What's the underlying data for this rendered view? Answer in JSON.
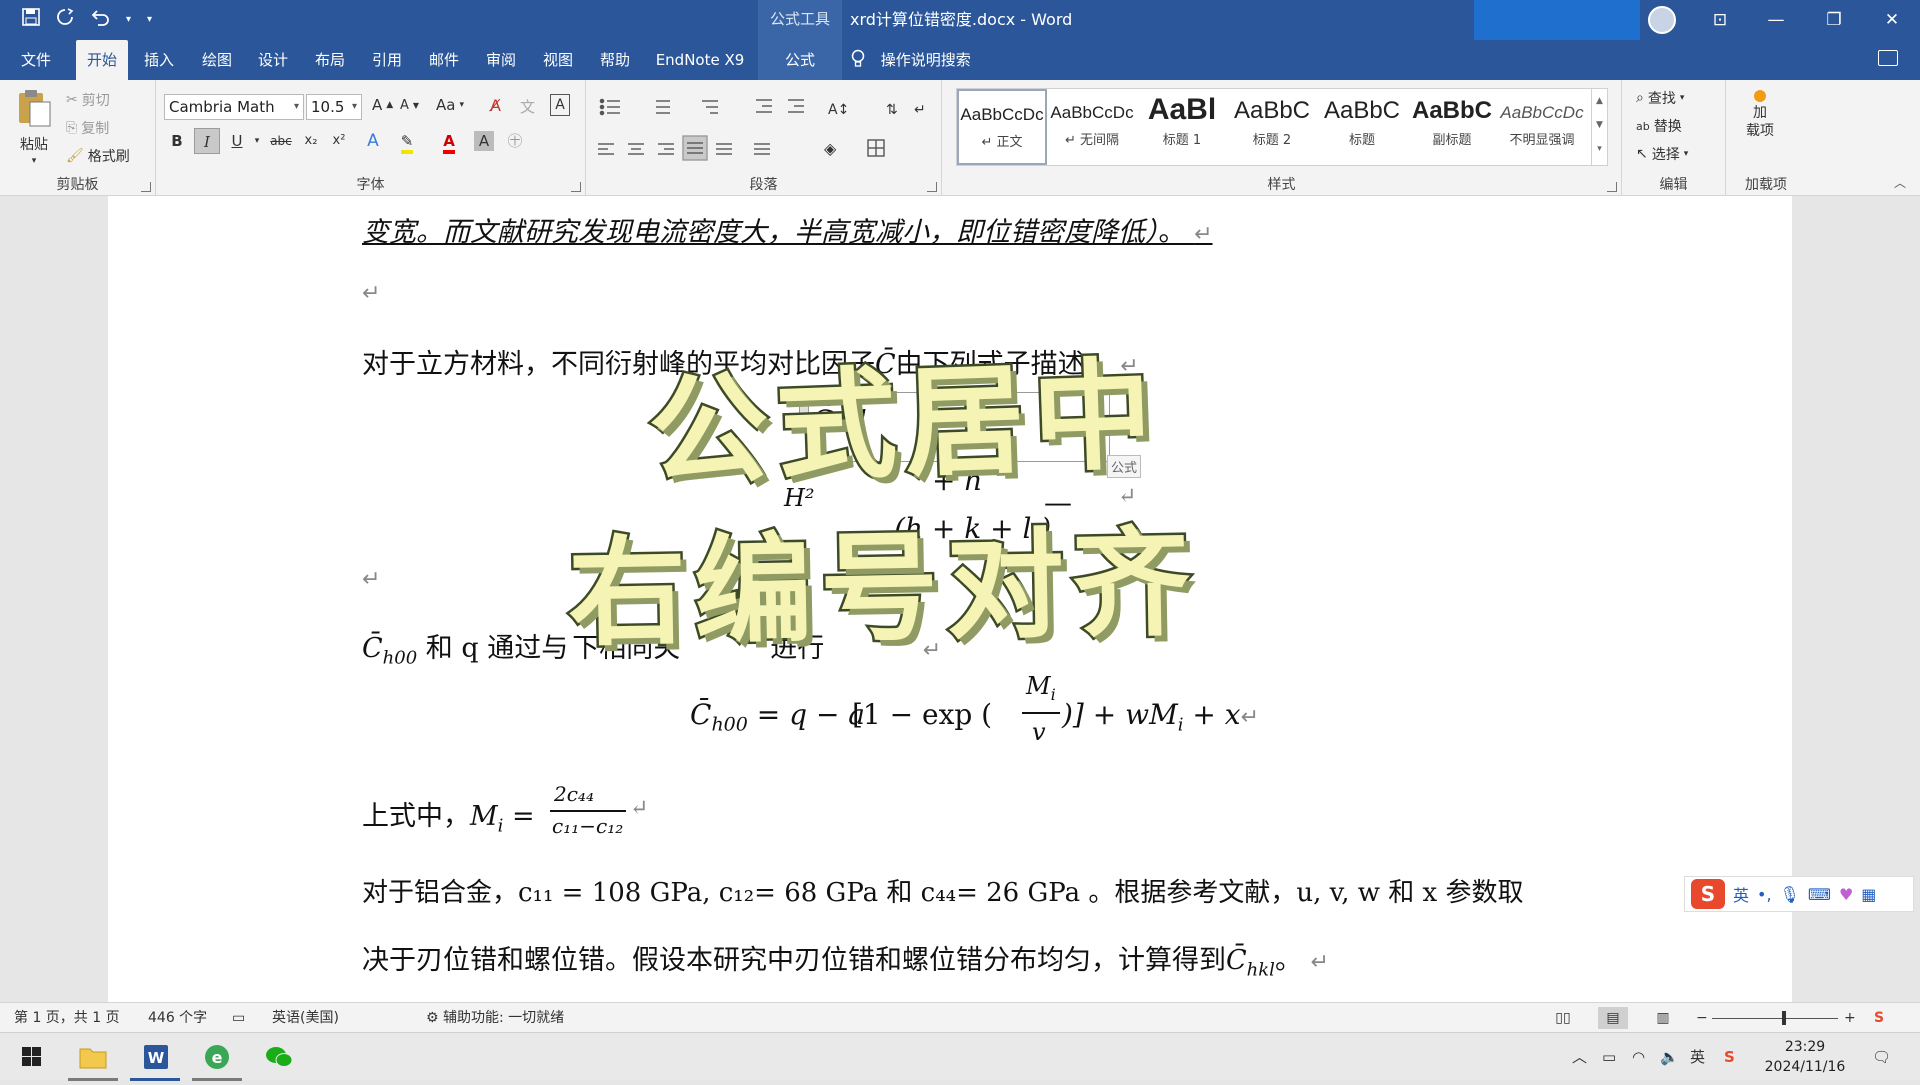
{
  "titlebar": {
    "context_label": "公式工具",
    "doc_title": "xrd计算位错密度.docx  -  Word",
    "min": "—",
    "restore": "❐",
    "close": "✕",
    "ribbon_display": "⊡"
  },
  "tabs": [
    "文件",
    "开始",
    "插入",
    "绘图",
    "设计",
    "布局",
    "引用",
    "邮件",
    "审阅",
    "视图",
    "帮助",
    "EndNote X9",
    "公式"
  ],
  "active_tab": "开始",
  "search": {
    "label": "操作说明搜索"
  },
  "ribbon": {
    "clipboard": {
      "paste": "粘贴",
      "cut": "剪切",
      "copy": "复制",
      "format_painter": "格式刷",
      "label": "剪贴板"
    },
    "font": {
      "font_name": "Cambria Math",
      "font_size": "10.5",
      "grow": "A",
      "shrink": "A",
      "case": "Aa",
      "bold": "B",
      "italic": "I",
      "underline": "U",
      "strike": "abc",
      "sub": "x₂",
      "sup": "x²",
      "label": "字体"
    },
    "paragraph": {
      "label": "段落"
    },
    "styles": {
      "label": "样式",
      "items": [
        {
          "sample": "AaBbCcDc",
          "name": "↵ 正文"
        },
        {
          "sample": "AaBbCcDc",
          "name": "↵ 无间隔"
        },
        {
          "sample": "AaBl",
          "name": "标题 1"
        },
        {
          "sample": "AaBbC",
          "name": "标题 2"
        },
        {
          "sample": "AaBbC",
          "name": "标题"
        },
        {
          "sample": "AaBbC",
          "name": "副标题"
        },
        {
          "sample": "AaBbCcDc",
          "name": "不明显强调"
        }
      ]
    },
    "editing": {
      "find": "查找",
      "replace": "替换",
      "select": "选择",
      "label": "编辑"
    },
    "addins": {
      "button": "加\n载项",
      "label": "加载项"
    }
  },
  "document": {
    "line1": "变宽。而文献研究发现电流密度大，半高宽减小，即位错密度降低）",
    "line1_end": "。",
    "para_cubic": "对于立方材料，不同衍射峰的平均对比因子",
    "para_cubic_sym": "C̄",
    "para_cubic_end": "由下列式子描述：",
    "eq1_top": "C̄   (1",
    "eq1_mid": "H²",
    "eq1_plus": "+ h",
    "eq1_minus": "—",
    "eq1_den": "(h  + k  + l )",
    "eq_tag": "公式",
    "para_ch00_sym": "C̄",
    "para_ch00_sub": "h00",
    "para_ch00_text": " 和 q 通过与",
    "para_ch00_text2": "下相同关",
    "para_ch00_text3": "进行",
    "eq2_left": "C̄",
    "eq2_sub": "h00",
    "eq2_body": " = q − a",
    "eq2_bracket": "[1 − exp (",
    "eq2_frac_num": "M",
    "eq2_frac_sub": "i",
    "eq2_frac_den": "v",
    "eq2_tail": ")] + wM",
    "eq2_tail_sub": "i",
    "eq2_tail2": " + x",
    "para_mi": "上式中，",
    "mi_lhs": "M",
    "mi_sub": "i",
    "mi_eq": " = ",
    "mi_num": "2c₄₄",
    "mi_den": "c₁₁−c₁₂",
    "para_al": "对于铝合金，c₁₁ = 108 GPa, c₁₂= 68 GPa 和 c₄₄= 26 GPa 。根据参考文献，u, v, w 和 x 参数取",
    "para_last": "决于刃位错和螺位错。假设本研究中刃位错和螺位错分布均匀，计算得到",
    "para_last_sym": "C̄",
    "para_last_sub": "hkl",
    "para_last_end": "。"
  },
  "overlay": {
    "line1": "公式居中",
    "line2": "右编号对齐"
  },
  "ime": {
    "lang": "英",
    "punct": "•,",
    "logo": "S"
  },
  "statusbar": {
    "page": "第 1 页，共 1 页",
    "words": "446 个字",
    "lang": "英语(美国)",
    "accessibility": "辅助功能: 一切就绪",
    "zoom_minus": "−",
    "zoom_plus": "+"
  },
  "taskbar": {
    "time": "23:29",
    "date": "2024/11/16",
    "ime_lang": "英"
  },
  "colors": {
    "word_blue": "#2b579a",
    "accent": "#1f6fcf"
  }
}
